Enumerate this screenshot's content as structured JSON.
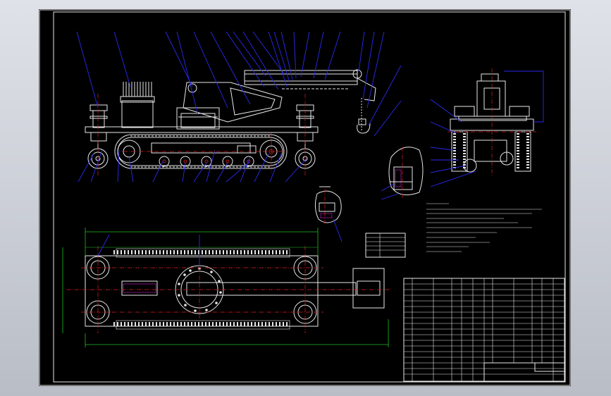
{
  "drawing": {
    "view_labels": {
      "side_view_title": "",
      "detail_title": ""
    },
    "colors": {
      "background": "#000000",
      "outline": "#e8e8e8",
      "leader": "#2a2af0",
      "centerline": "#e02020",
      "dimension": "#20c020",
      "hatch": "#d020d0"
    },
    "title_block_text": "",
    "notes_text": ""
  }
}
